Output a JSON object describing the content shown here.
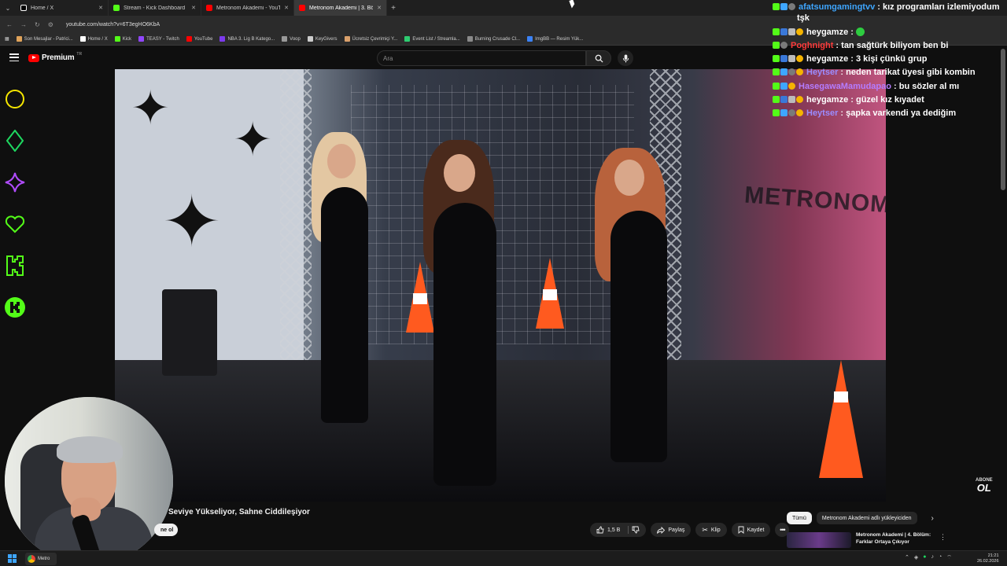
{
  "browser": {
    "tabs": [
      {
        "label": "Home / X",
        "color": "#ffffff",
        "active": false
      },
      {
        "label": "Stream - Kick Dashboard",
        "color": "#53fc18",
        "active": false
      },
      {
        "label": "Metronom Akademi - YouTube",
        "color": "#ff0000",
        "active": false
      },
      {
        "label": "Metronom Akademi | 3. Bö...",
        "color": "#ff0000",
        "active": true
      }
    ],
    "url": "youtube.com/watch?v=6T3egHO6KbA",
    "bookmarks": [
      {
        "label": "Son Mesajlar - Patrici...",
        "color": "#e0a35a"
      },
      {
        "label": "Home / X",
        "color": "#ffffff"
      },
      {
        "label": "Kick",
        "color": "#53fc18"
      },
      {
        "label": "TEASY - Twitch",
        "color": "#9146ff"
      },
      {
        "label": "YouTube",
        "color": "#ff0000"
      },
      {
        "label": "NBA 3. Lig B Katego...",
        "color": "#7c3aed"
      },
      {
        "label": "Voop",
        "color": "#999999"
      },
      {
        "label": "KeyGivers",
        "color": "#cccccc"
      },
      {
        "label": "Ücretsiz Çevrimiçi Y...",
        "color": "#d9a06b"
      },
      {
        "label": "Event List / Streamla...",
        "color": "#2ecc71"
      },
      {
        "label": "Burning Crusade Cl...",
        "color": "#8a8a8a"
      },
      {
        "label": "ImgBB — Resim Yük...",
        "color": "#3b82f6"
      }
    ]
  },
  "youtube": {
    "logo_text": "Premium",
    "logo_sup": "TR",
    "search_placeholder": "Ara",
    "video_title": "Seviye Yükseliyor, Sahne Ciddileşiyor",
    "subscribe_label": "ne ol",
    "like_count": "1,5 B",
    "share_label": "Paylaş",
    "clip_label": "Klip",
    "save_label": "Kaydet",
    "chips": [
      "Tümü",
      "Metronom Akademi adlı yükleyiciden"
    ],
    "rec_title": "Metronom Akademi | 4. Bölüm: Farklar Ortaya Çıkıyor",
    "abone": "ABONE",
    "ol": "OL",
    "video_sign": "METRONOM"
  },
  "chat": {
    "messages": [
      {
        "user": "afatsumgamingtvv",
        "color": "#3ea6ff",
        "text": "kız programları izlemiyodum tşk"
      },
      {
        "user": "heygamze",
        "color": "#ffffff",
        "text": ""
      },
      {
        "user": "Poghnight",
        "color": "#ff3b3b",
        "text": "tan sağtürk biliyom ben bi"
      },
      {
        "user": "heygamze",
        "color": "#ffffff",
        "text": "3 kişi çünkü grup"
      },
      {
        "user": "Heytser",
        "color": "#9b8cff",
        "text": "neden tarikat üyesi gibi kombin"
      },
      {
        "user": "HasegawaMamudapao",
        "color": "#b47cff",
        "text": "bu sözler al mı"
      },
      {
        "user": "heygamze",
        "color": "#ffffff",
        "text": "güzel kız kıyadet"
      },
      {
        "user": "Heytser",
        "color": "#9b8cff",
        "text": "şapka varkendi ya dediğim"
      }
    ],
    "separator": " : "
  },
  "taskbar": {
    "app_label": "Metro",
    "time": "21:21",
    "date": "26.02.2026"
  },
  "icons": {
    "overlay": [
      "circle-icon",
      "diamond-icon",
      "sparkle-icon",
      "heart-icon",
      "kick-k-icon",
      "kick-circle-icon"
    ]
  }
}
